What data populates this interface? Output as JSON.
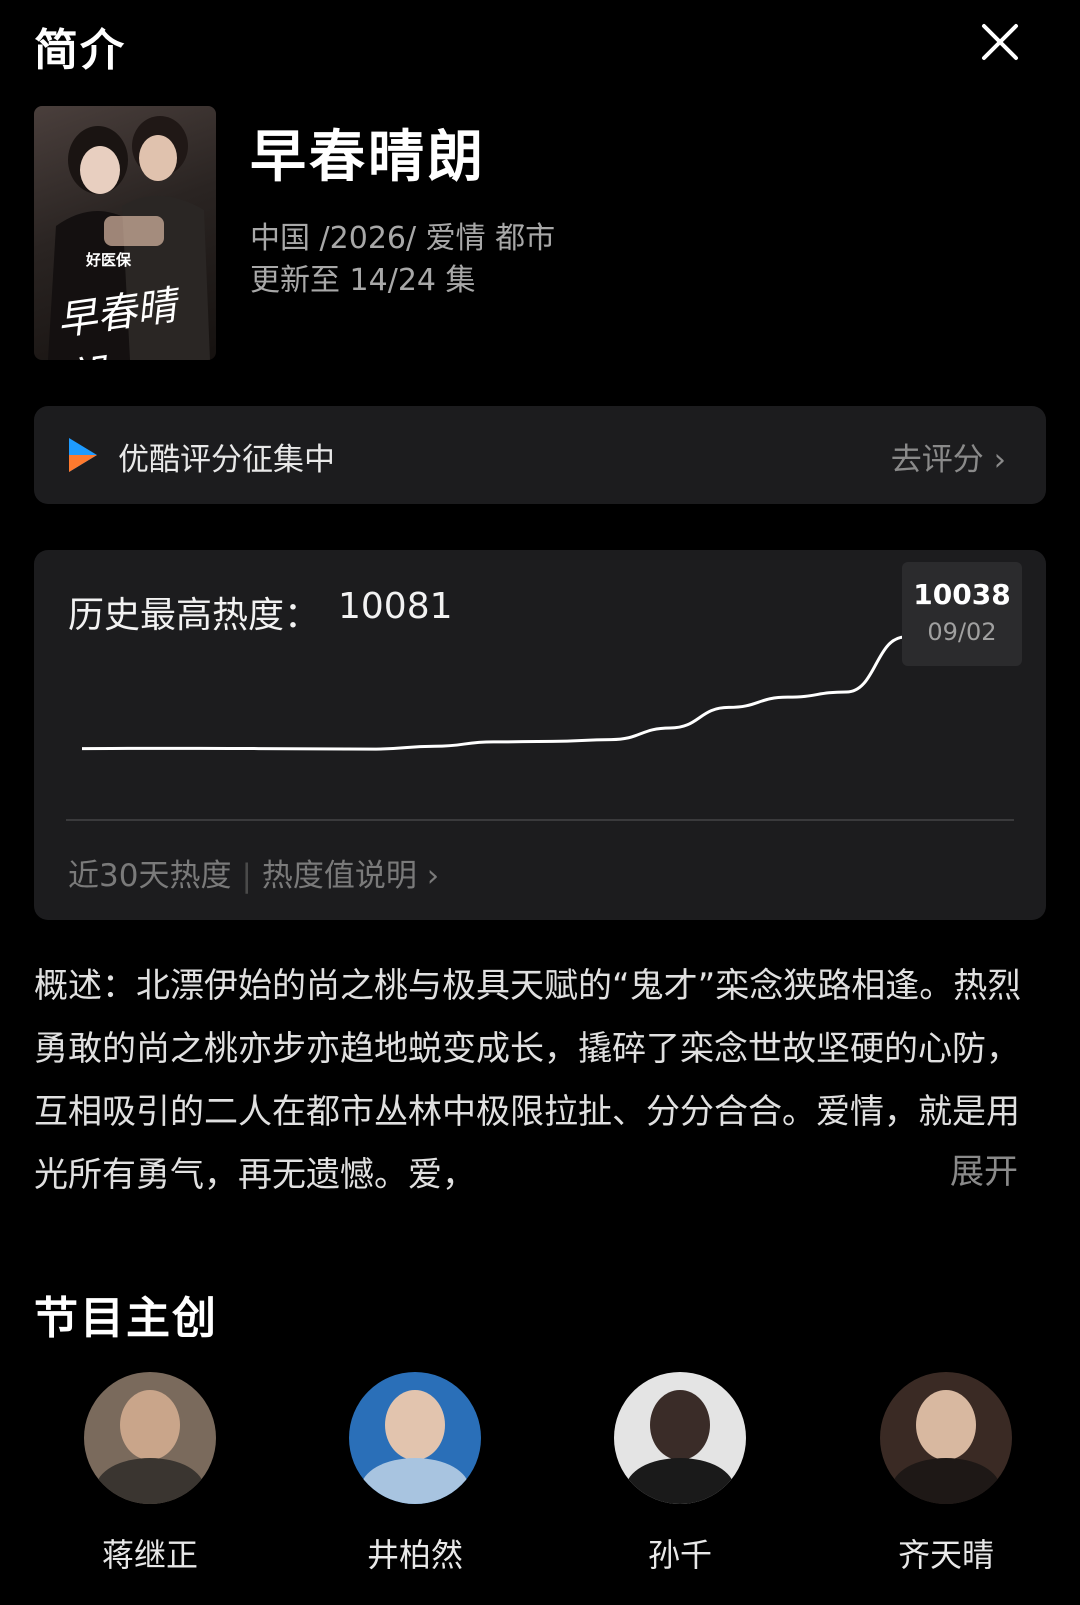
{
  "header": {
    "title": "简介",
    "close_icon": "close-icon"
  },
  "show": {
    "poster_watermark": "好医保",
    "poster_calligraphy": "早春晴朗",
    "title": "早春晴朗",
    "meta": "中国 /2026/ 爱情 都市",
    "update": "更新至 14/24 集"
  },
  "rating": {
    "logo": "youku-logo-icon",
    "label": "优酷评分征集中",
    "action": "去评分 ›"
  },
  "heat": {
    "label": "历史最高热度：",
    "max_value": "10081",
    "tooltip_value": "10038",
    "tooltip_date": "09/02",
    "footer_period": "近30天热度",
    "footer_link": "热度值说明 ›",
    "line_color": "#ffffff",
    "chart_data": {
      "type": "line",
      "series": [
        {
          "values": [
            9600,
            9601,
            9601,
            9600,
            9599,
            9598,
            9609,
            9626,
            9628,
            9635,
            9680,
            9760,
            9800,
            9820,
            10034,
            10038
          ]
        }
      ],
      "ylim": [
        9400,
        10100
      ],
      "grid": false,
      "highlight": {
        "value": 10038,
        "label": "09/02"
      }
    }
  },
  "synopsis": {
    "text": "概述：北漂伊始的尚之桃与极具天赋的“鬼才”栾念狭路相逢。热烈勇敢的尚之桃亦步亦趋地蜕变成长，撬碎了栾念世故坚硬的心防，互相吸引的二人在都市丛林中极限拉扯、分分合合。爱情，就是用光所有勇气，再无遗憾。爱，",
    "expand": "展开"
  },
  "cast_section": {
    "title": "节目主创",
    "members": [
      {
        "name": "蒋继正",
        "bg": "#7a6a5c",
        "head": "#c9a58a",
        "body": "#3a3530"
      },
      {
        "name": "井柏然",
        "bg": "#2a6fb8",
        "head": "#e2c4ae",
        "body": "#a8c4e0"
      },
      {
        "name": "孙千",
        "bg": "#e4e4e4",
        "head": "#3a2c28",
        "body": "#1a1a1a"
      },
      {
        "name": "齐天晴",
        "bg": "#3a2a24",
        "head": "#d8b8a0",
        "body": "#1e1816"
      }
    ]
  }
}
